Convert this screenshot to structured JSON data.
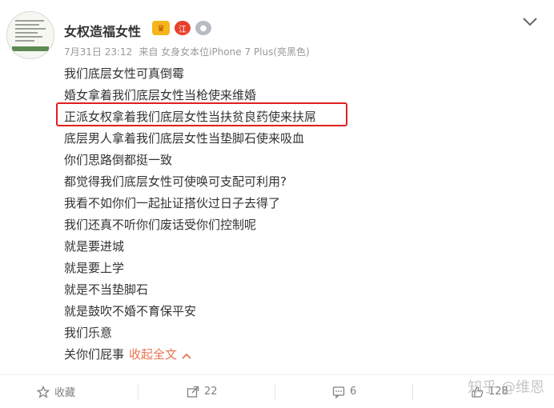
{
  "user": {
    "name": "女权造福女性",
    "badges": [
      "crown-badge",
      "level-badge",
      "medal-badge"
    ],
    "level_badge_text": "江"
  },
  "meta": {
    "date": "7月31日 23:12",
    "source": "来自 女身女本位iPhone 7 Plus(亮黑色)"
  },
  "post": {
    "lines": [
      "我们底层女性可真倒霉",
      "婚女拿着我们底层女性当枪使来维婚",
      "正派女权拿着我们底层女性当扶贫良药使来扶屌",
      "底层男人拿着我们底层女性当垫脚石使来吸血",
      "你们思路倒都挺一致",
      "都觉得我们底层女性可使唤可支配可利用?",
      "我看不如你们一起扯证搭伙过日子去得了",
      "我们还真不听你们废话受你们控制呢",
      "就是要进城",
      "就是要上学",
      "就是不当垫脚石",
      "就是鼓吹不婚不育保平安",
      "我们乐意"
    ],
    "last_line": "关你们屁事",
    "collapse_label": "收起全文"
  },
  "footer": {
    "favorite_label": "收藏",
    "repost_count": "22",
    "comment_count": "6",
    "like_count": "128"
  },
  "watermark": "知乎 @维恩",
  "colors": {
    "highlight_box": "#e02020",
    "link": "#eb7350",
    "text": "#333333",
    "muted": "#999999"
  }
}
